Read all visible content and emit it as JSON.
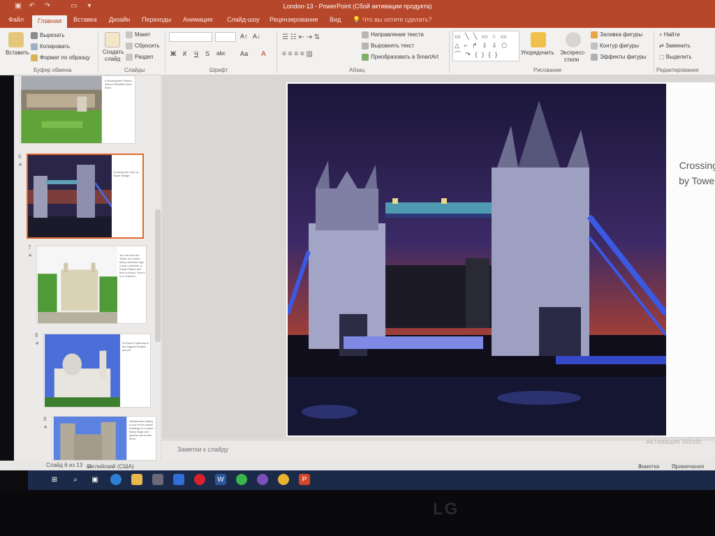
{
  "window": {
    "title": "London-13 - PowerPoint (Сбой активации продукта)"
  },
  "quick_access": [
    "save-icon",
    "undo-icon",
    "redo-icon",
    "present-icon",
    "customize-icon"
  ],
  "tabs": [
    {
      "label": "Файл",
      "active": false
    },
    {
      "label": "Главная",
      "active": true
    },
    {
      "label": "Вставка",
      "active": false
    },
    {
      "label": "Дизайн",
      "active": false
    },
    {
      "label": "Переходы",
      "active": false
    },
    {
      "label": "Анимация",
      "active": false
    },
    {
      "label": "Слайд-шоу",
      "active": false
    },
    {
      "label": "Рецензирование",
      "active": false
    },
    {
      "label": "Вид",
      "active": false
    }
  ],
  "tell_me": "Что вы хотите сделать?",
  "ribbon": {
    "clipboard": {
      "paste": "Вставить",
      "cut": "Вырезать",
      "copy": "Копировать",
      "format_painter": "Формат по образцу",
      "group": "Буфер обмена"
    },
    "slides": {
      "new_slide_1": "Создать",
      "new_slide_2": "слайд",
      "layout": "Макет",
      "reset": "Сбросить",
      "section": "Раздел",
      "group": "Слайды"
    },
    "font": {
      "bold": "Ж",
      "italic": "К",
      "underline": "Ч",
      "strike": "S",
      "spacing": "abc",
      "aa": "Аа",
      "letter": "А",
      "group": "Шрифт"
    },
    "paragraph": {
      "direction": "Направление текста",
      "align_text": "Выровнять текст",
      "smartart": "Преобразовать в SmartArt",
      "group": "Абзац"
    },
    "drawing": {
      "arrange": "Упорядочить",
      "styles_1": "Экспресс-",
      "styles_2": "стили",
      "fill": "Заливка фигуры",
      "outline": "Контур фигуры",
      "effects": "Эффекты фигуры",
      "group": "Рисование"
    },
    "editing": {
      "find": "Найти",
      "replace": "Заменить",
      "select": "Выделить",
      "group": "Редактирование"
    }
  },
  "thumbnails": [
    {
      "num": "",
      "caption": "e Buckingham Palace, Queen Elizabeth lives there.",
      "selected": false
    },
    {
      "num": "6",
      "caption": "Crossing the river by Tower Bridge",
      "selected": true
    },
    {
      "num": "7",
      "caption": "You can see the Tower of London. Many centuries ago it was a fortress, a Royal Palace and then a prison. Now it is a museum.",
      "selected": false
    },
    {
      "num": "8",
      "caption": "St Paul's Cathedral is the biggest English church.",
      "selected": false
    },
    {
      "num": "9",
      "caption": "Westminster Abbey is one of the oldest buildings in London. Many kings and queens are buried there.",
      "selected": false
    }
  ],
  "slide": {
    "caption_line1": "Crossing",
    "caption_line2": "by Tower"
  },
  "notes_placeholder": "Заметки к слайду",
  "activation_watermark": "Активация Windo",
  "status": {
    "slide_count": "Слайд 6 из 13",
    "language": "английский (США)",
    "notes": "Заметки",
    "comments": "Примечания"
  },
  "taskbar_icons": [
    "windows-icon",
    "search-icon",
    "task-view-icon",
    "edge-icon",
    "file-explorer-icon",
    "store-icon",
    "mail-icon",
    "opera-icon",
    "word-icon",
    "whatsapp-icon",
    "viber-icon",
    "chrome-icon",
    "powerpoint-icon"
  ],
  "colors": {
    "accent": "#b7472a",
    "selection": "#e0672b",
    "taskbar": "#1b2a48"
  },
  "brand": "LG"
}
